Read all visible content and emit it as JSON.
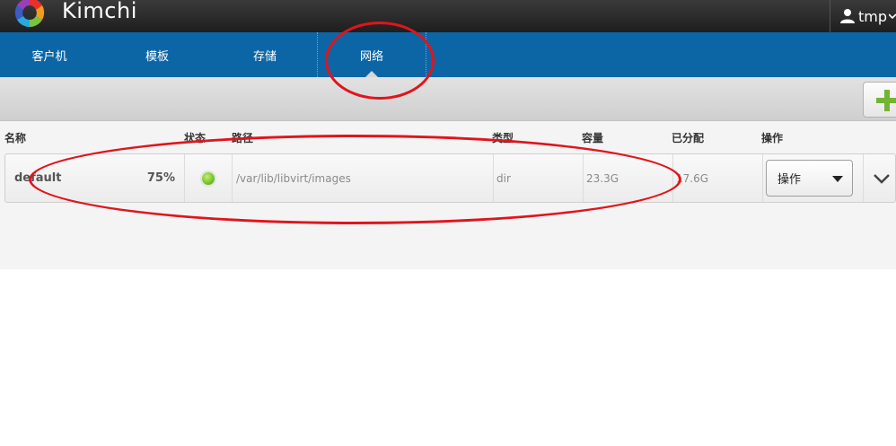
{
  "app": {
    "title": "Kimchi"
  },
  "user": {
    "name": "tmp",
    "icon": "user-icon"
  },
  "nav": {
    "tabs": [
      {
        "label": "客户机"
      },
      {
        "label": "模板"
      },
      {
        "label": "存储"
      },
      {
        "label": "网络",
        "active": true
      }
    ]
  },
  "toolbar": {
    "add_icon": "plus-icon",
    "add_color": "#72b532"
  },
  "table": {
    "headers": [
      "名称",
      "状态",
      "路径",
      "类型",
      "容量",
      "已分配",
      "操作"
    ],
    "rows": [
      {
        "name": "default",
        "usage": "75%",
        "state": "active",
        "state_color": "#69b91d",
        "path": "/var/lib/libvirt/images",
        "type": "dir",
        "capacity": "23.3G",
        "allocated": "17.6G",
        "action_label": "操作"
      }
    ]
  },
  "colors": {
    "nav": "#0c66a6",
    "topbar": "#2a2a2a",
    "annotation": "#e1141c"
  }
}
